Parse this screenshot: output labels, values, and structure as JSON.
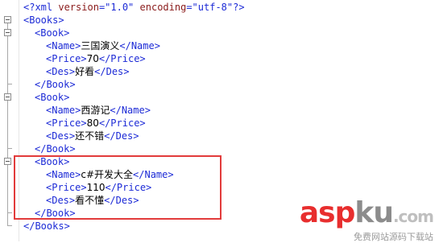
{
  "xml_decl": {
    "open": "<?xml ",
    "version_attr": "version",
    "version_value": "=\"1.0\"",
    "encoding_attr": "encoding",
    "encoding_value": "=\"utf-8\"",
    "close": "?>"
  },
  "root_open": "<Books>",
  "root_close": "</Books>",
  "book_open": "<Book>",
  "book_close": "</Book>",
  "tags": {
    "name_open": "<Name>",
    "name_close": "</Name>",
    "price_open": "<Price>",
    "price_close": "</Price>",
    "des_open": "<Des>",
    "des_close": "</Des>"
  },
  "books": [
    {
      "name": "三国演义",
      "price": "70",
      "des": "好看"
    },
    {
      "name": "西游记",
      "price": "80",
      "des": "还不错"
    },
    {
      "name": "c#开发大全",
      "price": "110",
      "des": "看不懂"
    }
  ],
  "watermark": {
    "asp": "asp",
    "ku": "ku",
    "com": ".com",
    "sub": "免费网站源码下载站"
  },
  "colors": {
    "tag_blue": "#1c2ad6",
    "highlight_red": "#e23b3b",
    "watermark_red": "#e82e2e"
  }
}
